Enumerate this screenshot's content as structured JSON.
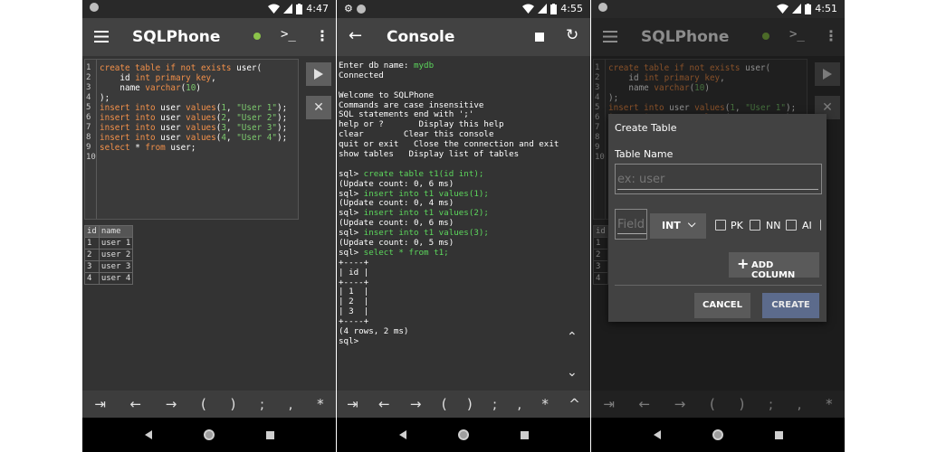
{
  "colors": {
    "bg": "#333333",
    "appbar": "#424242",
    "status": "#292929",
    "keyword": "#f2904a",
    "string": "#7cc96e",
    "green_dot": "#8bc34a",
    "console_green": "#5cd65c",
    "create_btn": "#5c6b8c"
  },
  "screens": [
    {
      "status": {
        "time": "4:47",
        "icons": [
          "notification-dot-icon",
          "wifi-icon",
          "signal-icon",
          "battery-icon"
        ]
      },
      "appbar": {
        "title": "SQLPhone",
        "icons": [
          "menu-icon",
          "status-dot-icon",
          "terminal-icon",
          "more-vert-icon"
        ]
      },
      "line_numbers": [
        "1",
        "2",
        "3",
        "4",
        "5",
        "6",
        "7",
        "8",
        "9",
        "10"
      ],
      "code": [
        [
          [
            "kw",
            "create table if not exists "
          ],
          [
            "plain",
            "user("
          ]
        ],
        [
          [
            "plain",
            "    id "
          ],
          [
            "kw",
            "int primary key"
          ],
          [
            "plain",
            ","
          ]
        ],
        [
          [
            "plain",
            "    name "
          ],
          [
            "kw",
            "varchar"
          ],
          [
            "plain",
            "("
          ],
          [
            "num",
            "10"
          ],
          [
            "plain",
            ")"
          ]
        ],
        [
          [
            "plain",
            ");"
          ]
        ],
        [
          [
            "kw",
            "insert into "
          ],
          [
            "plain",
            "user "
          ],
          [
            "kw",
            "values"
          ],
          [
            "plain",
            "("
          ],
          [
            "num",
            "1"
          ],
          [
            "plain",
            ", "
          ],
          [
            "str",
            "\"User 1\""
          ],
          [
            "plain",
            ");"
          ]
        ],
        [
          [
            "kw",
            "insert into "
          ],
          [
            "plain",
            "user "
          ],
          [
            "kw",
            "values"
          ],
          [
            "plain",
            "("
          ],
          [
            "num",
            "2"
          ],
          [
            "plain",
            ", "
          ],
          [
            "str",
            "\"User 2\""
          ],
          [
            "plain",
            ");"
          ]
        ],
        [
          [
            "kw",
            "insert into "
          ],
          [
            "plain",
            "user "
          ],
          [
            "kw",
            "values"
          ],
          [
            "plain",
            "("
          ],
          [
            "num",
            "3"
          ],
          [
            "plain",
            ", "
          ],
          [
            "str",
            "\"User 3\""
          ],
          [
            "plain",
            ");"
          ]
        ],
        [
          [
            "kw",
            "insert into "
          ],
          [
            "plain",
            "user "
          ],
          [
            "kw",
            "values"
          ],
          [
            "plain",
            "("
          ],
          [
            "num",
            "4"
          ],
          [
            "plain",
            ", "
          ],
          [
            "str",
            "\"User 4\""
          ],
          [
            "plain",
            ");"
          ]
        ],
        [
          [
            "kw",
            "select "
          ],
          [
            "plain",
            "* "
          ],
          [
            "kw",
            "from "
          ],
          [
            "plain",
            "user;"
          ]
        ],
        [
          [
            "plain",
            ""
          ]
        ]
      ],
      "side_buttons": [
        "play-icon",
        "close-icon"
      ],
      "results": {
        "headers": [
          "id",
          "name"
        ],
        "rows": [
          [
            "1",
            "user 1"
          ],
          [
            "2",
            "user 2"
          ],
          [
            "3",
            "user 3"
          ],
          [
            "4",
            "user 4"
          ]
        ]
      },
      "symbols": [
        "⇥",
        "←",
        "→",
        "(",
        ")",
        ";",
        ",",
        "*"
      ]
    },
    {
      "status": {
        "time": "4:55",
        "icons": [
          "gear-icon",
          "notification-dot-icon",
          "wifi-icon",
          "signal-icon",
          "battery-icon"
        ]
      },
      "appbar": {
        "title": "Console",
        "icons": [
          "back-arrow-icon",
          "stop-icon",
          "refresh-icon"
        ]
      },
      "console": [
        [
          [
            "plain",
            "Enter db name: "
          ],
          [
            "green",
            "mydb"
          ]
        ],
        [
          [
            "plain",
            "Connected"
          ]
        ],
        [
          [
            "plain",
            ""
          ]
        ],
        [
          [
            "plain",
            "Welcome to SQLPhone"
          ]
        ],
        [
          [
            "plain",
            "Commands are case insensitive"
          ]
        ],
        [
          [
            "plain",
            "SQL statements end with ';'"
          ]
        ],
        [
          [
            "plain",
            "help or ?       Display this help"
          ]
        ],
        [
          [
            "plain",
            "clear        Clear this console"
          ]
        ],
        [
          [
            "plain",
            "quit or exit   Close the connection and exit"
          ]
        ],
        [
          [
            "plain",
            "show tables   Display list of tables"
          ]
        ],
        [
          [
            "plain",
            ""
          ]
        ],
        [
          [
            "plain",
            "sql> "
          ],
          [
            "green",
            "create table t1(id int);"
          ]
        ],
        [
          [
            "plain",
            "(Update count: 0, 6 ms)"
          ]
        ],
        [
          [
            "plain",
            "sql> "
          ],
          [
            "green",
            "insert into t1 values(1);"
          ]
        ],
        [
          [
            "plain",
            "(Update count: 0, 4 ms)"
          ]
        ],
        [
          [
            "plain",
            "sql> "
          ],
          [
            "green",
            "insert into t1 values(2);"
          ]
        ],
        [
          [
            "plain",
            "(Update count: 0, 6 ms)"
          ]
        ],
        [
          [
            "plain",
            "sql> "
          ],
          [
            "green",
            "insert into t1 values(3);"
          ]
        ],
        [
          [
            "plain",
            "(Update count: 0, 5 ms)"
          ]
        ],
        [
          [
            "plain",
            "sql> "
          ],
          [
            "green",
            "select * from t1;"
          ]
        ],
        [
          [
            "plain",
            "+----+"
          ]
        ],
        [
          [
            "plain",
            "| id |"
          ]
        ],
        [
          [
            "plain",
            "+----+"
          ]
        ],
        [
          [
            "plain",
            "| 1  |"
          ]
        ],
        [
          [
            "plain",
            "| 2  |"
          ]
        ],
        [
          [
            "plain",
            "| 3  |"
          ]
        ],
        [
          [
            "plain",
            "+----+"
          ]
        ],
        [
          [
            "plain",
            "(4 rows, 2 ms)"
          ]
        ],
        [
          [
            "plain",
            "sql>"
          ]
        ]
      ],
      "scroll_icons": [
        "chevron-up-icon",
        "chevron-down-icon"
      ],
      "symbols": [
        "⇥",
        "←",
        "→",
        "(",
        ")",
        ";",
        ",",
        "*",
        "^"
      ]
    },
    {
      "status": {
        "time": "4:51",
        "icons": [
          "notification-dot-icon",
          "wifi-icon",
          "signal-icon",
          "battery-icon"
        ]
      },
      "dialog": {
        "title": "Create Table",
        "table_name_label": "Table Name",
        "table_name_placeholder": "ex: user",
        "field_placeholder": "Field",
        "type_value": "INT",
        "checkboxes": [
          "PK",
          "NN",
          "AI"
        ],
        "add_column_label": "ADD COLUMN",
        "cancel_label": "CANCEL",
        "create_label": "CREATE"
      }
    }
  ]
}
